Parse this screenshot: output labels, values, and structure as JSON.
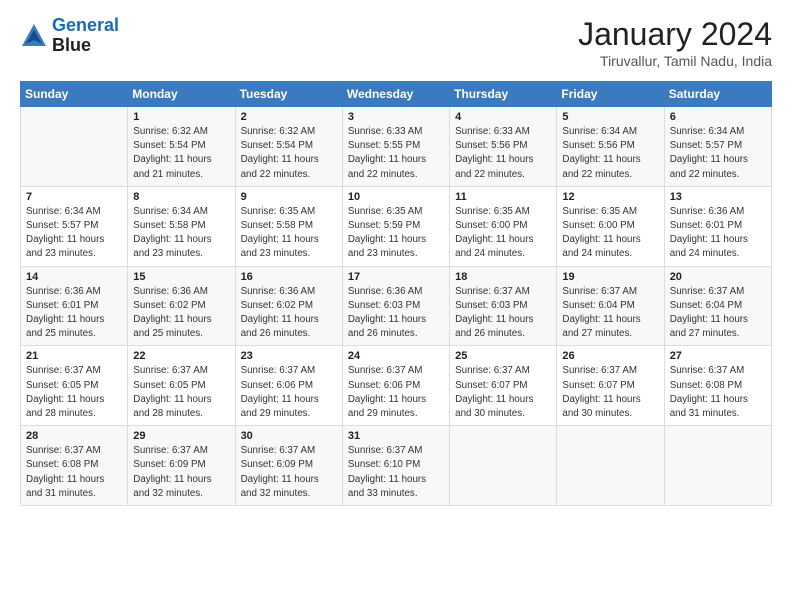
{
  "header": {
    "logo_line1": "General",
    "logo_line2": "Blue",
    "month_title": "January 2024",
    "subtitle": "Tiruvallur, Tamil Nadu, India"
  },
  "weekdays": [
    "Sunday",
    "Monday",
    "Tuesday",
    "Wednesday",
    "Thursday",
    "Friday",
    "Saturday"
  ],
  "weeks": [
    [
      {
        "day": "",
        "info": ""
      },
      {
        "day": "1",
        "info": "Sunrise: 6:32 AM\nSunset: 5:54 PM\nDaylight: 11 hours\nand 21 minutes."
      },
      {
        "day": "2",
        "info": "Sunrise: 6:32 AM\nSunset: 5:54 PM\nDaylight: 11 hours\nand 22 minutes."
      },
      {
        "day": "3",
        "info": "Sunrise: 6:33 AM\nSunset: 5:55 PM\nDaylight: 11 hours\nand 22 minutes."
      },
      {
        "day": "4",
        "info": "Sunrise: 6:33 AM\nSunset: 5:56 PM\nDaylight: 11 hours\nand 22 minutes."
      },
      {
        "day": "5",
        "info": "Sunrise: 6:34 AM\nSunset: 5:56 PM\nDaylight: 11 hours\nand 22 minutes."
      },
      {
        "day": "6",
        "info": "Sunrise: 6:34 AM\nSunset: 5:57 PM\nDaylight: 11 hours\nand 22 minutes."
      }
    ],
    [
      {
        "day": "7",
        "info": "Sunrise: 6:34 AM\nSunset: 5:57 PM\nDaylight: 11 hours\nand 23 minutes."
      },
      {
        "day": "8",
        "info": "Sunrise: 6:34 AM\nSunset: 5:58 PM\nDaylight: 11 hours\nand 23 minutes."
      },
      {
        "day": "9",
        "info": "Sunrise: 6:35 AM\nSunset: 5:58 PM\nDaylight: 11 hours\nand 23 minutes."
      },
      {
        "day": "10",
        "info": "Sunrise: 6:35 AM\nSunset: 5:59 PM\nDaylight: 11 hours\nand 23 minutes."
      },
      {
        "day": "11",
        "info": "Sunrise: 6:35 AM\nSunset: 6:00 PM\nDaylight: 11 hours\nand 24 minutes."
      },
      {
        "day": "12",
        "info": "Sunrise: 6:35 AM\nSunset: 6:00 PM\nDaylight: 11 hours\nand 24 minutes."
      },
      {
        "day": "13",
        "info": "Sunrise: 6:36 AM\nSunset: 6:01 PM\nDaylight: 11 hours\nand 24 minutes."
      }
    ],
    [
      {
        "day": "14",
        "info": "Sunrise: 6:36 AM\nSunset: 6:01 PM\nDaylight: 11 hours\nand 25 minutes."
      },
      {
        "day": "15",
        "info": "Sunrise: 6:36 AM\nSunset: 6:02 PM\nDaylight: 11 hours\nand 25 minutes."
      },
      {
        "day": "16",
        "info": "Sunrise: 6:36 AM\nSunset: 6:02 PM\nDaylight: 11 hours\nand 26 minutes."
      },
      {
        "day": "17",
        "info": "Sunrise: 6:36 AM\nSunset: 6:03 PM\nDaylight: 11 hours\nand 26 minutes."
      },
      {
        "day": "18",
        "info": "Sunrise: 6:37 AM\nSunset: 6:03 PM\nDaylight: 11 hours\nand 26 minutes."
      },
      {
        "day": "19",
        "info": "Sunrise: 6:37 AM\nSunset: 6:04 PM\nDaylight: 11 hours\nand 27 minutes."
      },
      {
        "day": "20",
        "info": "Sunrise: 6:37 AM\nSunset: 6:04 PM\nDaylight: 11 hours\nand 27 minutes."
      }
    ],
    [
      {
        "day": "21",
        "info": "Sunrise: 6:37 AM\nSunset: 6:05 PM\nDaylight: 11 hours\nand 28 minutes."
      },
      {
        "day": "22",
        "info": "Sunrise: 6:37 AM\nSunset: 6:05 PM\nDaylight: 11 hours\nand 28 minutes."
      },
      {
        "day": "23",
        "info": "Sunrise: 6:37 AM\nSunset: 6:06 PM\nDaylight: 11 hours\nand 29 minutes."
      },
      {
        "day": "24",
        "info": "Sunrise: 6:37 AM\nSunset: 6:06 PM\nDaylight: 11 hours\nand 29 minutes."
      },
      {
        "day": "25",
        "info": "Sunrise: 6:37 AM\nSunset: 6:07 PM\nDaylight: 11 hours\nand 30 minutes."
      },
      {
        "day": "26",
        "info": "Sunrise: 6:37 AM\nSunset: 6:07 PM\nDaylight: 11 hours\nand 30 minutes."
      },
      {
        "day": "27",
        "info": "Sunrise: 6:37 AM\nSunset: 6:08 PM\nDaylight: 11 hours\nand 31 minutes."
      }
    ],
    [
      {
        "day": "28",
        "info": "Sunrise: 6:37 AM\nSunset: 6:08 PM\nDaylight: 11 hours\nand 31 minutes."
      },
      {
        "day": "29",
        "info": "Sunrise: 6:37 AM\nSunset: 6:09 PM\nDaylight: 11 hours\nand 32 minutes."
      },
      {
        "day": "30",
        "info": "Sunrise: 6:37 AM\nSunset: 6:09 PM\nDaylight: 11 hours\nand 32 minutes."
      },
      {
        "day": "31",
        "info": "Sunrise: 6:37 AM\nSunset: 6:10 PM\nDaylight: 11 hours\nand 33 minutes."
      },
      {
        "day": "",
        "info": ""
      },
      {
        "day": "",
        "info": ""
      },
      {
        "day": "",
        "info": ""
      }
    ]
  ]
}
